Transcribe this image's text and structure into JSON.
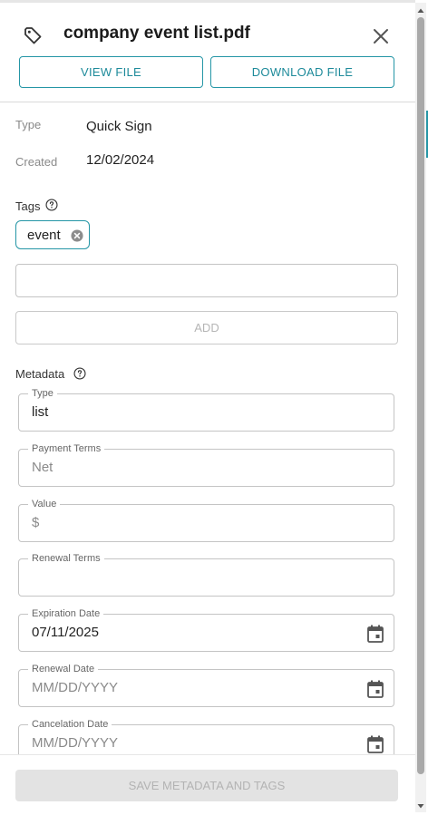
{
  "header": {
    "file_name": "company event list.pdf",
    "view_file_label": "VIEW FILE",
    "download_file_label": "DOWNLOAD FILE"
  },
  "info": {
    "type_label": "Type",
    "type_value": "Quick Sign",
    "created_label": "Created",
    "created_value": "12/02/2024"
  },
  "tags": {
    "section_label": "Tags",
    "items": [
      {
        "label": "event"
      }
    ],
    "input_value": "",
    "add_label": "ADD"
  },
  "metadata": {
    "section_label": "Metadata",
    "fields": [
      {
        "label": "Type",
        "value": "list",
        "placeholder": ""
      },
      {
        "label": "Payment Terms",
        "value": "",
        "placeholder": "Net"
      },
      {
        "label": "Value",
        "value": "",
        "placeholder": "$"
      },
      {
        "label": "Renewal Terms",
        "value": "",
        "placeholder": ""
      },
      {
        "label": "Expiration Date",
        "value": "07/11/2025",
        "placeholder": "MM/DD/YYYY"
      },
      {
        "label": "Renewal Date",
        "value": "",
        "placeholder": "MM/DD/YYYY"
      },
      {
        "label": "Cancelation Date",
        "value": "",
        "placeholder": "MM/DD/YYYY"
      }
    ]
  },
  "footer": {
    "save_label": "SAVE METADATA AND TAGS"
  },
  "icons": {
    "tag": "tag-icon",
    "close": "close-icon",
    "help": "help-circle-icon",
    "chip_delete": "cancel-circle-icon",
    "calendar": "calendar-icon"
  },
  "colors": {
    "accent": "#2596a6",
    "disabled_bg": "#e3e3e3",
    "disabled_text": "#b3b3b3",
    "label_gray": "#8a8a8a"
  }
}
